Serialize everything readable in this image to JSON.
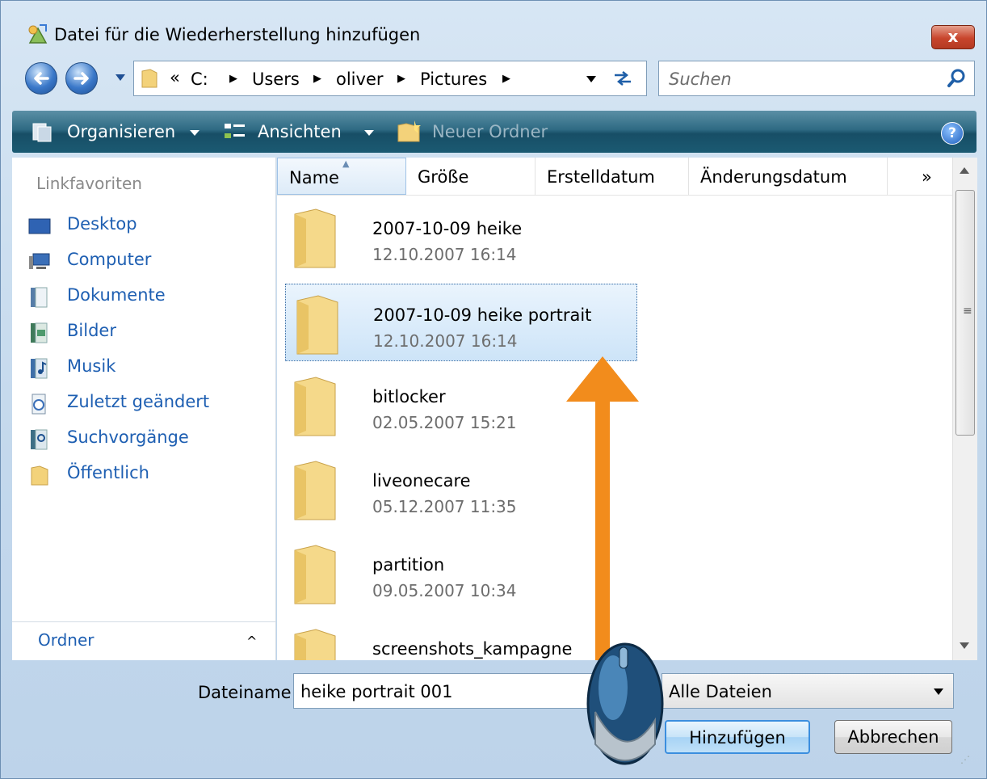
{
  "window": {
    "title": "Datei für die Wiederherstellung hinzufügen",
    "close_label": "x"
  },
  "address": {
    "chevrons": "«",
    "crumbs": [
      "C:",
      "Users",
      "oliver",
      "Pictures"
    ]
  },
  "search": {
    "placeholder": "Suchen"
  },
  "toolbar": {
    "organize": "Organisieren",
    "views": "Ansichten",
    "new_folder": "Neuer Ordner",
    "help": "?"
  },
  "sidebar": {
    "header": "Linkfavoriten",
    "items": [
      {
        "label": "Desktop",
        "icon": "desktop-icon"
      },
      {
        "label": "Computer",
        "icon": "computer-icon"
      },
      {
        "label": "Dokumente",
        "icon": "documents-icon"
      },
      {
        "label": "Bilder",
        "icon": "pictures-icon"
      },
      {
        "label": "Musik",
        "icon": "music-icon"
      },
      {
        "label": "Zuletzt geändert",
        "icon": "recent-icon"
      },
      {
        "label": "Suchvorgänge",
        "icon": "searches-icon"
      },
      {
        "label": "Öffentlich",
        "icon": "public-folder-icon"
      }
    ],
    "folders_label": "Ordner",
    "folders_caret": "^"
  },
  "columns": {
    "name": "Name",
    "size": "Größe",
    "created": "Erstelldatum",
    "modified": "Änderungsdatum",
    "more": "»"
  },
  "files": [
    {
      "name": "2007-10-09 heike",
      "date": "12.10.2007 16:14"
    },
    {
      "name": "2007-10-09 heike portrait",
      "date": "12.10.2007 16:14",
      "selected": true
    },
    {
      "name": "bitlocker",
      "date": "02.05.2007 15:21"
    },
    {
      "name": "liveonecare",
      "date": "05.12.2007 11:35"
    },
    {
      "name": "partition",
      "date": "09.05.2007 10:34"
    },
    {
      "name": "screenshots_kampagne",
      "date": ""
    }
  ],
  "bottom": {
    "filename_label": "Dateiname:",
    "filename_value": "heike portrait 001",
    "filetype": "Alle Dateien",
    "add_button": "Hinzufügen",
    "cancel_button": "Abbrechen"
  },
  "colors": {
    "accent": "#1e5fb2",
    "toolbar": "#1b5a72",
    "arrow": "#f28c1c",
    "selection": "#cde4f8"
  }
}
